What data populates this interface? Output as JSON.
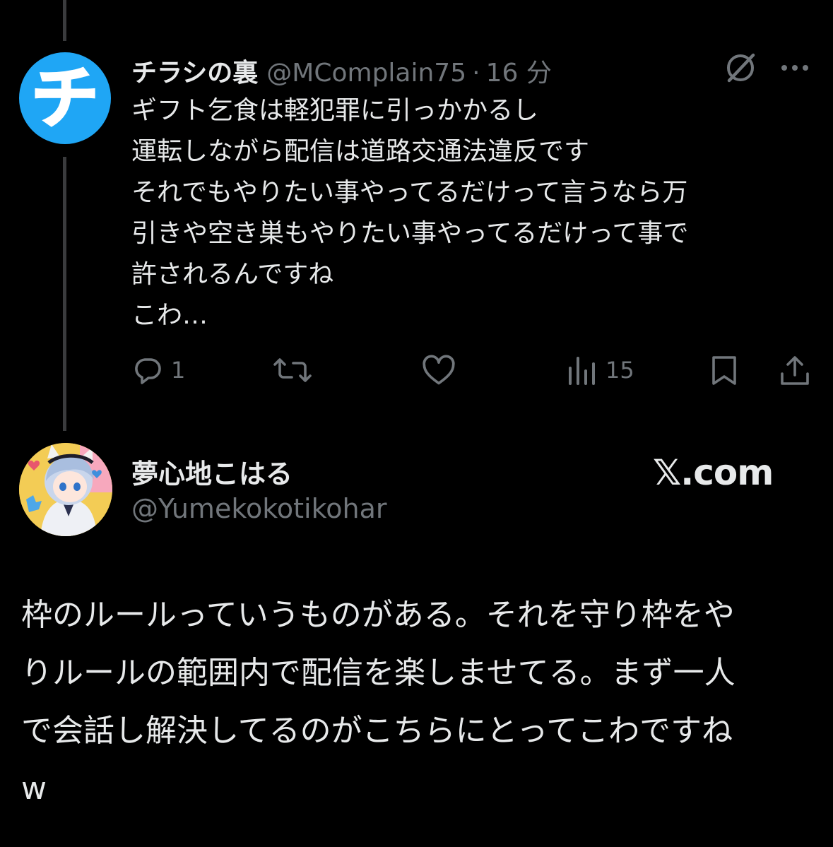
{
  "post1": {
    "author_name": "チラシの裏",
    "author_handle": "@MComplain75",
    "separator": "·",
    "time": "16 分",
    "avatar_glyph": "チ",
    "avatar_color": "#1fa6f5",
    "lines": [
      "ギフト乞食は軽犯罪に引っかかるし",
      "運転しながら配信は道路交通法違反です",
      "それでもやりたい事やってるだけって言うなら万",
      "引きや空き巣もやりたい事やってるだけって事で",
      "許されるんですね",
      "こわ…"
    ],
    "actions": {
      "reply_icon": "reply-icon",
      "reply_count": "1",
      "repost_icon": "repost-icon",
      "like_icon": "like-icon",
      "views_icon": "views-icon",
      "views_count": "15",
      "bookmark_icon": "bookmark-icon",
      "share_icon": "share-icon"
    },
    "header_icons": [
      "grok-icon",
      "more-icon"
    ]
  },
  "post2": {
    "author_name": "夢心地こはる",
    "author_handle": "@Yumekokotikohar",
    "source": "𝕏.com",
    "lines": [
      "枠のルールっていうものがある。それを守り枠をや",
      "りルールの範囲内で配信を楽しませてる。まず一人",
      "で会話し解決してるのがこちらにとってこわですね",
      "w"
    ]
  },
  "colors": {
    "background": "#000000",
    "text_primary": "#e7e9ea",
    "text_secondary": "#71767b",
    "thread_line": "#3a3b3d"
  }
}
